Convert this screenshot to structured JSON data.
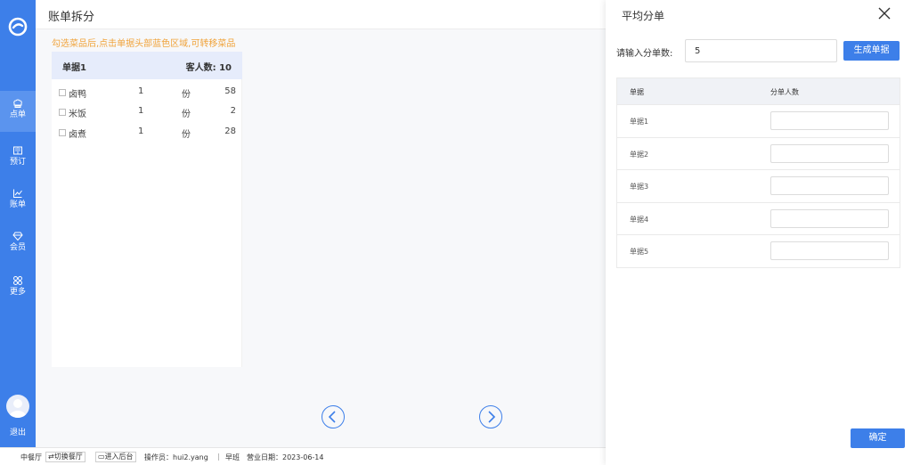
{
  "sidebar": {
    "items": [
      {
        "label": "点单",
        "icon": "chef-hat-icon"
      },
      {
        "label": "预订",
        "icon": "book-icon"
      },
      {
        "label": "账单",
        "icon": "chart-icon"
      },
      {
        "label": "会员",
        "icon": "diamond-icon"
      },
      {
        "label": "更多",
        "icon": "grid-icon"
      }
    ],
    "logout_label": "退出"
  },
  "header": {
    "title": "账单拆分"
  },
  "hint": "勾选菜品后,点击单据头部蓝色区域,可转移菜品",
  "bill": {
    "name": "单据1",
    "guest_count": "客人数: 10",
    "dishes": [
      {
        "name": "卤鸭",
        "qty": "1",
        "unit": "份",
        "price": "58"
      },
      {
        "name": "米饭",
        "qty": "1",
        "unit": "份",
        "price": "2"
      },
      {
        "name": "卤煮",
        "qty": "1",
        "unit": "份",
        "price": "28"
      }
    ]
  },
  "status_bar": {
    "hall": "中餐厅",
    "switch_hall": "切换餐厅",
    "backend": "进入后台",
    "operator": "操作员：hui2.yang",
    "separator": "|",
    "shift": "早班",
    "business_date": "营业日期：2023-06-14"
  },
  "panel": {
    "title": "平均分单",
    "split_label": "请输入分单数:",
    "split_value": "5",
    "generate_label": "生成单据",
    "table_headers": [
      "单据",
      "分单人数"
    ],
    "rows": [
      {
        "name": "单据1",
        "value": ""
      },
      {
        "name": "单据2",
        "value": ""
      },
      {
        "name": "单据3",
        "value": ""
      },
      {
        "name": "单据4",
        "value": ""
      },
      {
        "name": "单据5",
        "value": ""
      }
    ],
    "confirm_label": "确定"
  },
  "colors": {
    "primary": "#3d7fe9",
    "hint": "#f0a33b",
    "bill_head": "#e6ecfb"
  }
}
